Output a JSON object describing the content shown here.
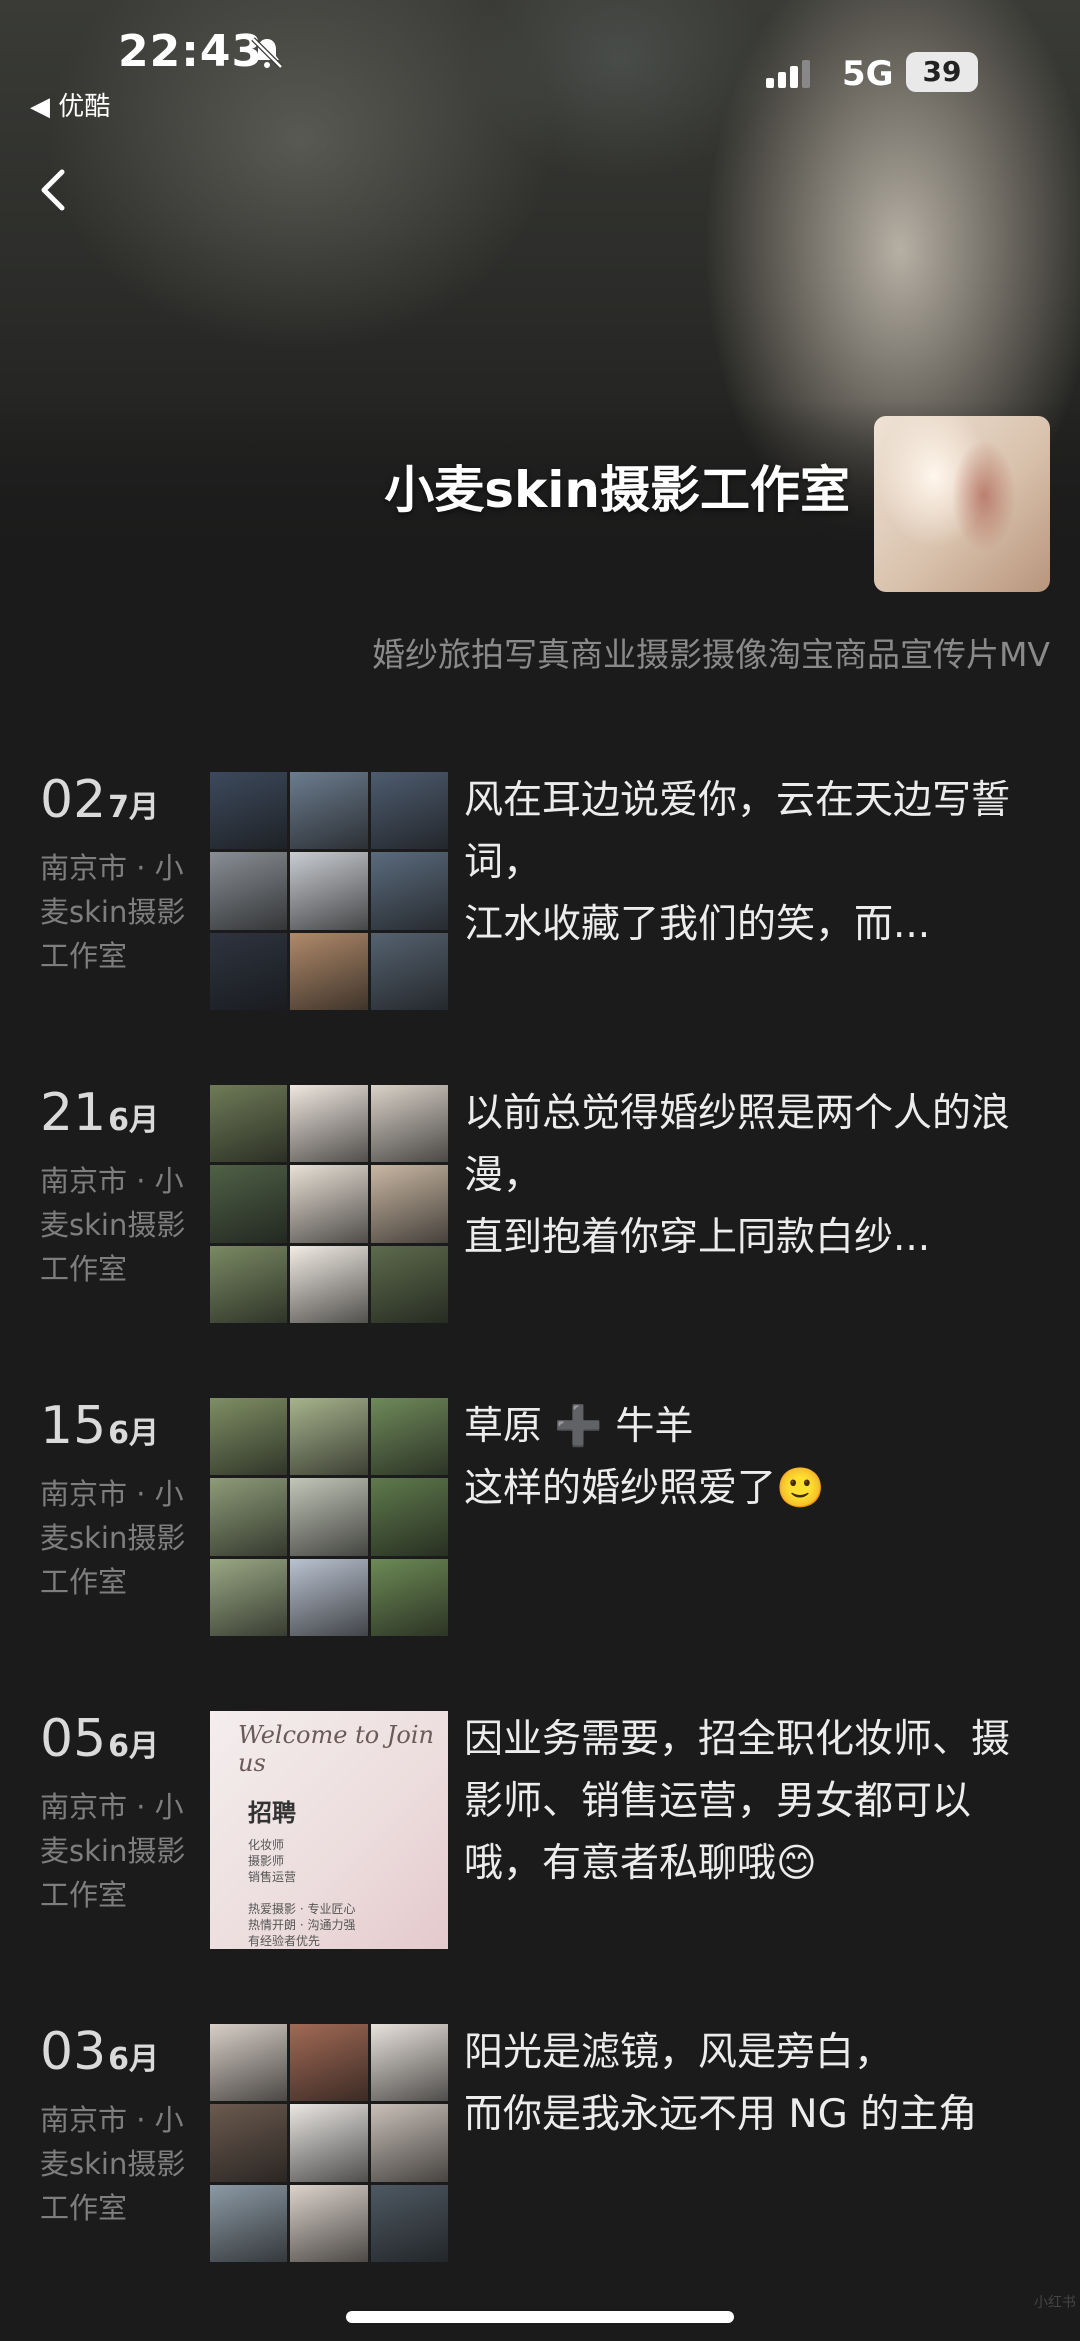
{
  "status_bar": {
    "time": "22:43",
    "back_app": "◀ 优酷",
    "network": "5G",
    "battery": "39"
  },
  "header": {
    "studio_name": "小麦skin摄影工作室",
    "bio": "婚纱旅拍写真商业摄影摄像淘宝商品宣传片MV"
  },
  "posts": [
    {
      "day": "02",
      "month": "7月",
      "location": "南京市 · 小麦skin摄影工作室",
      "caption": "风在耳边说爱你，云在天边写誓词，\n江水收藏了我们的笑，而...",
      "colors": [
        "#3d4a5c",
        "#6c7c8e",
        "#4e5c6f",
        "#8a8f95",
        "#c9ccd1",
        "#5b6b7d",
        "#2e3440",
        "#b08a6a",
        "#556270"
      ]
    },
    {
      "day": "21",
      "month": "6月",
      "location": "南京市 · 小麦skin摄影工作室",
      "caption": "以前总觉得婚纱照是两个人的浪漫，\n直到抱着你穿上同款白纱...",
      "colors": [
        "#6f7b57",
        "#efe7df",
        "#d9d2c8",
        "#4f6147",
        "#e9e1d6",
        "#c9b7a3",
        "#7a8a63",
        "#f1ece4",
        "#5d6b4c"
      ]
    },
    {
      "day": "15",
      "month": "6月",
      "location": "南京市 · 小麦skin摄影工作室",
      "caption": "草原 ➕ 牛羊\n这样的婚纱照爱了🙂",
      "colors": [
        "#7f8f64",
        "#a7b38c",
        "#6f8a5a",
        "#8e9c78",
        "#c2c6b8",
        "#5f7a4c",
        "#9aa884",
        "#b9c2d0",
        "#6d8a55"
      ]
    },
    {
      "day": "05",
      "month": "6月",
      "location": "南京市 · 小麦skin摄影工作室",
      "caption": "因业务需要，招全职化妆师、摄影师、销售运营，男女都可以哦，有意者私聊哦😊",
      "poster": {
        "welcome": "Welcome to Join us",
        "title": "招聘",
        "lines": "化妆师\n摄影师\n销售运营\n\n热爱摄影 · 专业匠心\n热情开朗 · 沟通力强\n有经验者优先"
      }
    },
    {
      "day": "03",
      "month": "6月",
      "location": "南京市 · 小麦skin摄影工作室",
      "caption": "阳光是滤镜，风是旁白，\n而你是我永远不用 NG 的主角",
      "colors": [
        "#d8cfc7",
        "#a26a55",
        "#e8e2dc",
        "#6b5a4f",
        "#e9e6e3",
        "#c9c0b8",
        "#8c9aa5",
        "#dcd3cb",
        "#4e5963"
      ]
    }
  ],
  "watermark": "小红书"
}
